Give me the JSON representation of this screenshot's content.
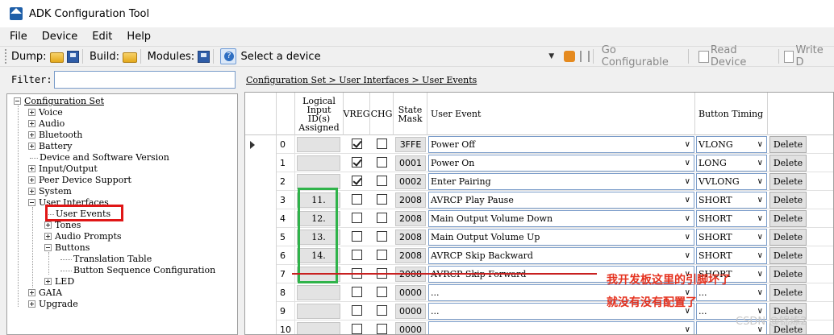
{
  "window": {
    "title": "ADK Configuration Tool"
  },
  "menu": [
    "File",
    "Device",
    "Edit",
    "Help"
  ],
  "toolbar": {
    "dump_label": "Dump:",
    "build_label": "Build:",
    "modules_label": "Modules:",
    "device_select_value": "Select a device",
    "go_configurable": "Go Configurable",
    "read_device": "Read Device",
    "write_device": "Write D"
  },
  "filter": {
    "label": "Filter:",
    "value": ""
  },
  "breadcrumb": "Configuration Set > User Interfaces > User Events",
  "tree": [
    {
      "label": "Configuration Set",
      "level": 0,
      "expander": "minus"
    },
    {
      "label": "Voice",
      "level": 1,
      "expander": "plus"
    },
    {
      "label": "Audio",
      "level": 1,
      "expander": "plus"
    },
    {
      "label": "Bluetooth",
      "level": 1,
      "expander": "plus"
    },
    {
      "label": "Battery",
      "level": 1,
      "expander": "plus"
    },
    {
      "label": "Device and Software Version",
      "level": 1,
      "expander": "none"
    },
    {
      "label": "Input/Output",
      "level": 1,
      "expander": "plus"
    },
    {
      "label": "Peer Device Support",
      "level": 1,
      "expander": "plus"
    },
    {
      "label": "System",
      "level": 1,
      "expander": "plus"
    },
    {
      "label": "User Interfaces",
      "level": 1,
      "expander": "minus"
    },
    {
      "label": "User Events",
      "level": 2,
      "expander": "none"
    },
    {
      "label": "Tones",
      "level": 2,
      "expander": "plus"
    },
    {
      "label": "Audio Prompts",
      "level": 2,
      "expander": "plus"
    },
    {
      "label": "Buttons",
      "level": 2,
      "expander": "minus"
    },
    {
      "label": "Translation Table",
      "level": 3,
      "expander": "none"
    },
    {
      "label": "Button Sequence Configuration",
      "level": 3,
      "expander": "none"
    },
    {
      "label": "LED",
      "level": 2,
      "expander": "plus"
    },
    {
      "label": "GAIA",
      "level": 1,
      "expander": "plus"
    },
    {
      "label": "Upgrade",
      "level": 1,
      "expander": "plus"
    }
  ],
  "grid": {
    "headers": {
      "logical_input": "Logical Input ID(s) Assigned",
      "vreg": "VREG",
      "chg": "CHG",
      "state_mask": "State Mask",
      "user_event": "User Event",
      "button_timing": "Button Timing"
    },
    "delete_label": "Delete",
    "rows": [
      {
        "index": "0",
        "logical": "",
        "vreg": true,
        "chg": false,
        "mask": "3FFE",
        "event": "Power Off",
        "timing": "VLONG"
      },
      {
        "index": "1",
        "logical": "",
        "vreg": true,
        "chg": false,
        "mask": "0001",
        "event": "Power On",
        "timing": "LONG"
      },
      {
        "index": "2",
        "logical": "",
        "vreg": true,
        "chg": false,
        "mask": "0002",
        "event": "Enter Pairing",
        "timing": "VVLONG"
      },
      {
        "index": "3",
        "logical": "11.",
        "vreg": false,
        "chg": false,
        "mask": "2008",
        "event": "AVRCP Play Pause",
        "timing": "SHORT"
      },
      {
        "index": "4",
        "logical": "12.",
        "vreg": false,
        "chg": false,
        "mask": "2008",
        "event": "Main Output Volume Down",
        "timing": "SHORT"
      },
      {
        "index": "5",
        "logical": "13.",
        "vreg": false,
        "chg": false,
        "mask": "2008",
        "event": "Main Output Volume Up",
        "timing": "SHORT"
      },
      {
        "index": "6",
        "logical": "14.",
        "vreg": false,
        "chg": false,
        "mask": "2008",
        "event": "AVRCP Skip Backward",
        "timing": "SHORT"
      },
      {
        "index": "7",
        "logical": "",
        "vreg": false,
        "chg": false,
        "mask": "2008",
        "event": "AVRCP Skip Forward",
        "timing": "SHORT"
      },
      {
        "index": "8",
        "logical": "",
        "vreg": false,
        "chg": false,
        "mask": "0000",
        "event": "...",
        "timing": "..."
      },
      {
        "index": "9",
        "logical": "",
        "vreg": false,
        "chg": false,
        "mask": "0000",
        "event": "...",
        "timing": "..."
      },
      {
        "index": "10",
        "logical": "",
        "vreg": false,
        "chg": false,
        "mask": "0000",
        "event": "",
        "timing": ""
      }
    ]
  },
  "annotation": {
    "line1": "我开发板这里的引脚坏了",
    "line2": "就没有没有配置了",
    "color": "#e5321f"
  },
  "watermark": "CSDN @锦炼2"
}
